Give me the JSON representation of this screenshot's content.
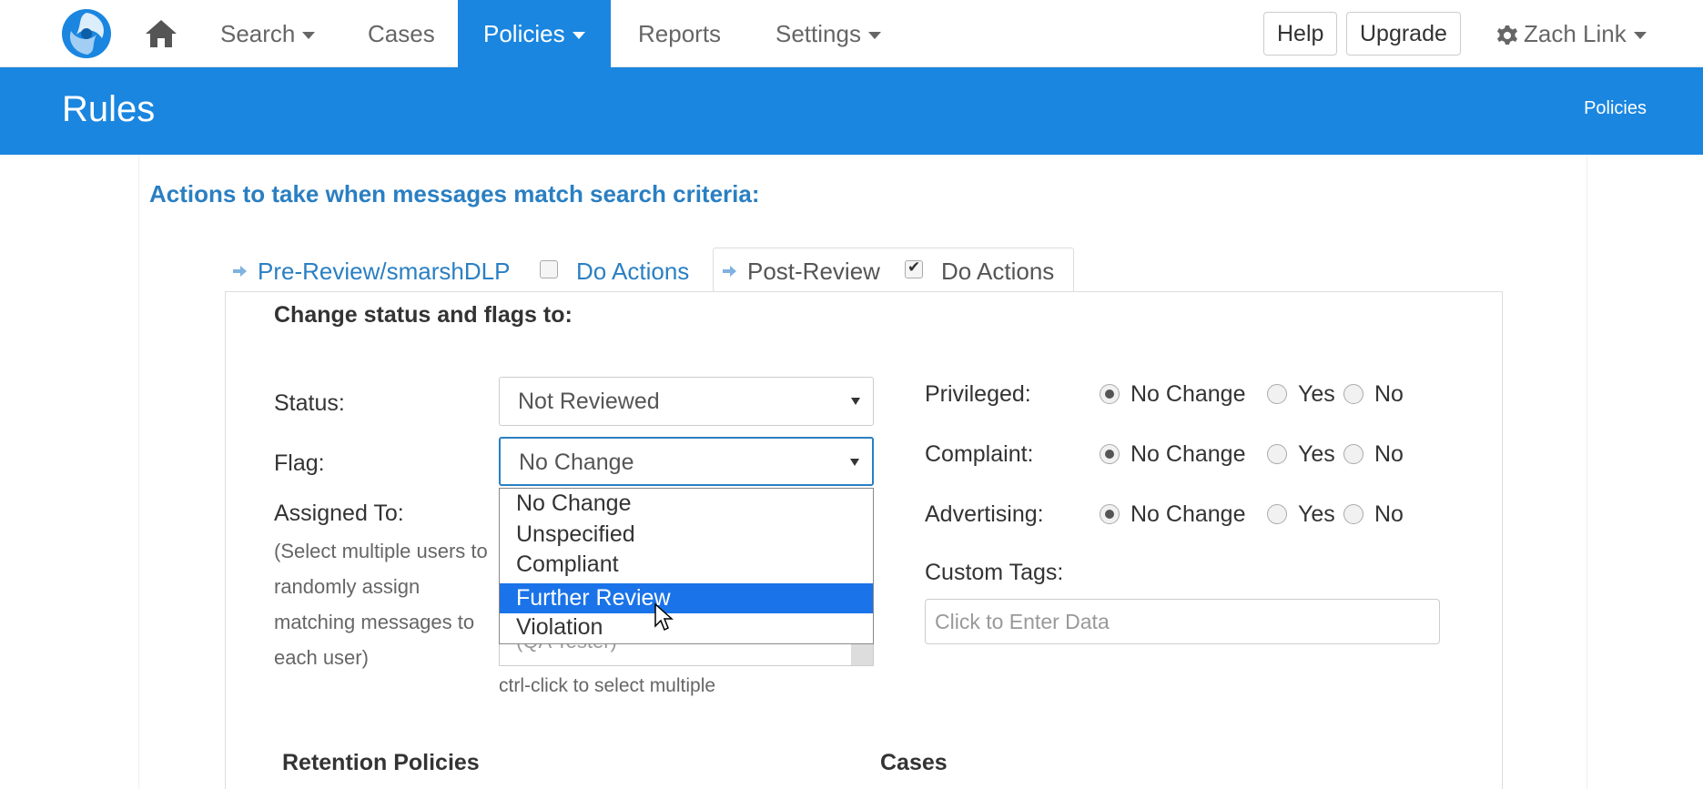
{
  "nav": {
    "items": [
      {
        "label": "Search",
        "has_caret": true
      },
      {
        "label": "Cases",
        "has_caret": false
      },
      {
        "label": "Policies",
        "has_caret": true,
        "active": true
      },
      {
        "label": "Reports",
        "has_caret": false
      },
      {
        "label": "Settings",
        "has_caret": true
      }
    ],
    "help_label": "Help",
    "upgrade_label": "Upgrade",
    "user_label": "Zach Link"
  },
  "header": {
    "title": "Rules",
    "breadcrumb": "Policies"
  },
  "actions": {
    "section_title": "Actions to take when messages match search criteria:",
    "tabs": [
      {
        "label": "Pre-Review/smarshDLP",
        "do_actions_label": "Do Actions",
        "checked": false
      },
      {
        "label": "Post-Review",
        "do_actions_label": "Do Actions",
        "checked": true,
        "active": true
      }
    ]
  },
  "form": {
    "subheading": "Change status and flags to:",
    "status_label": "Status:",
    "status_value": "Not Reviewed",
    "flag_label": "Flag:",
    "flag_value": "No Change",
    "flag_options": [
      "No Change",
      "Unspecified",
      "Compliant",
      "Further Review",
      "Violation"
    ],
    "flag_highlighted": "Further Review",
    "assigned_label": "Assigned To:",
    "assigned_help": "(Select multiple users to randomly assign matching messages to each user)",
    "assigned_peek": "(QA Tester)",
    "ctrl_hint": "ctrl-click to select multiple",
    "radios": [
      {
        "label": "Privileged:",
        "options": [
          "No Change",
          "Yes",
          "No"
        ],
        "selected": "No Change"
      },
      {
        "label": "Complaint:",
        "options": [
          "No Change",
          "Yes",
          "No"
        ],
        "selected": "No Change"
      },
      {
        "label": "Advertising:",
        "options": [
          "No Change",
          "Yes",
          "No"
        ],
        "selected": "No Change"
      }
    ],
    "custom_tags_label": "Custom Tags:",
    "custom_tags_placeholder": "Click to Enter Data",
    "retention_label": "Retention Policies",
    "cases_label": "Cases"
  },
  "colors": {
    "brand_blue": "#1a86e0",
    "link_blue": "#2a7fc2",
    "highlight": "#1a73e8"
  }
}
